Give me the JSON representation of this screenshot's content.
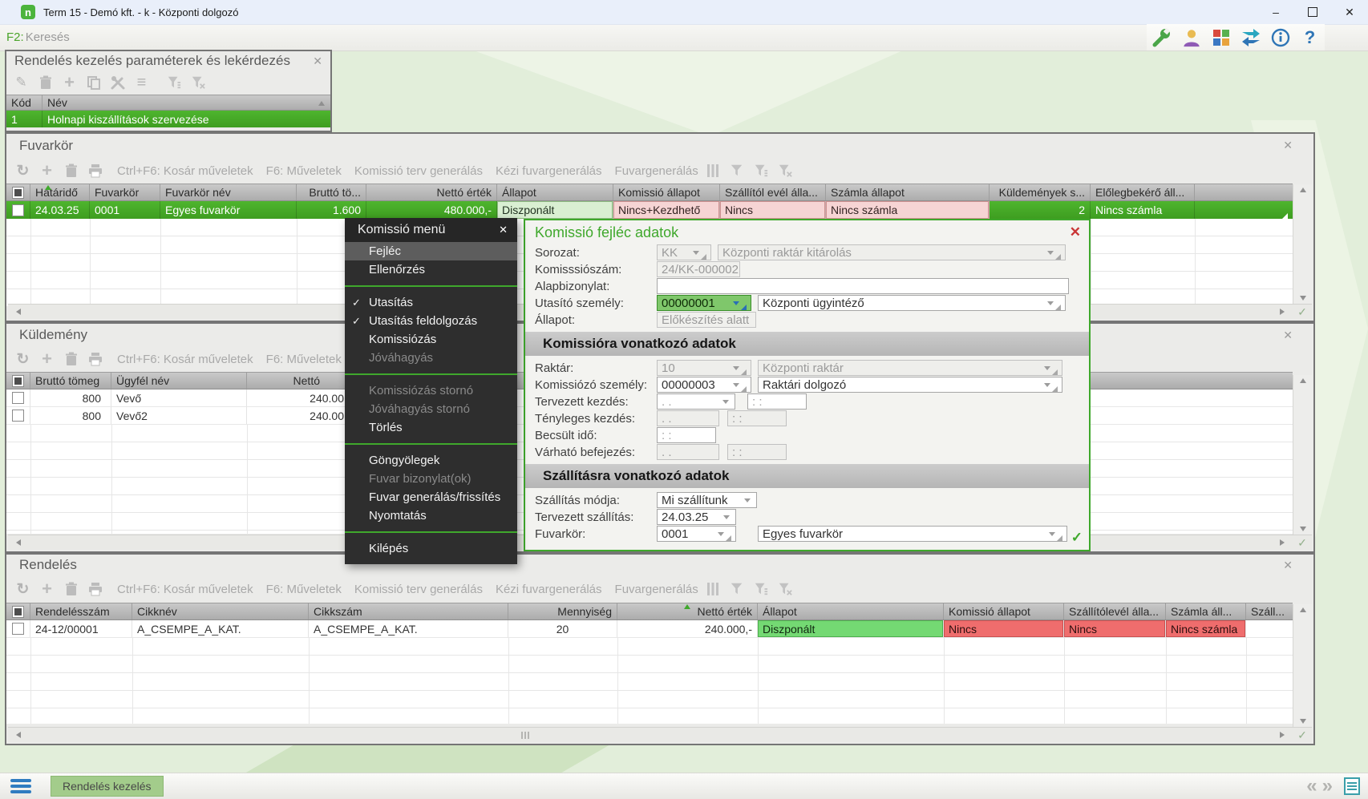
{
  "window": {
    "title": "Term 15 - Demó kft. - k - Központi dolgozó",
    "app_letter": "n",
    "minimize": "–",
    "close": "✕"
  },
  "topbar": {
    "shortcut": "F2:",
    "search_label": "Keresés"
  },
  "ui": {
    "close": "✕",
    "check": "✓"
  },
  "param_panel": {
    "title": "Rendelés kezelés paraméterek és lekérdezés",
    "col_kod": "Kód",
    "col_nev": "Név",
    "row_kod": "1",
    "row_nev": "Holnapi kiszállítások szervezése"
  },
  "toolbar_labels": {
    "kosar": "Ctrl+F6: Kosár műveletek",
    "muveletek": "F6: Műveletek",
    "komissio_terv": "Komissió terv generálás",
    "kezi_fuvar": "Kézi fuvargenerálás",
    "fuvargen": "Fuvargenerálás"
  },
  "fuvarkor": {
    "title": "Fuvarkör",
    "cols": {
      "hatarido": "Határidő",
      "fuvarkor": "Fuvarkör",
      "nev": "Fuvarkör név",
      "brutto": "Bruttó tö...",
      "netto": "Nettó érték",
      "allapot": "Állapot",
      "komissio": "Komissió állapot",
      "szallitolevel": "Szállítól evél álla...",
      "szamla": "Számla állapot",
      "kuldemenyek": "Küldemények s...",
      "eloleg": "Előlegbekérő áll..."
    },
    "row": {
      "hatarido": "24.03.25",
      "fuvarkor": "0001",
      "nev": "Egyes fuvarkör",
      "brutto": "1.600",
      "netto": "480.000,-",
      "allapot": "Diszponált",
      "komissio": "Nincs+Kezdhető",
      "szallitolevel": "Nincs",
      "szamla": "Nincs számla",
      "kuldemenyek": "2",
      "eloleg": "Nincs számla"
    }
  },
  "kuldemeny": {
    "title": "Küldemény",
    "cols": {
      "brutto": "Bruttó tömeg",
      "ugyfel": "Ügyfél név",
      "netto": "Nettó"
    },
    "rows": [
      {
        "brutto": "800",
        "ugyfel": "Vevő",
        "netto": "240.00"
      },
      {
        "brutto": "800",
        "ugyfel": "Vevő2",
        "netto": "240.00"
      }
    ]
  },
  "rendeles": {
    "title": "Rendelés",
    "cols": {
      "szam": "Rendelésszám",
      "cikknev": "Cikknév",
      "cikkszam": "Cikkszám",
      "mennyiseg": "Mennyiség",
      "netto": "Nettó érték",
      "allapot": "Állapot",
      "komissio": "Komissió állapot",
      "szallitolevel": "Szállítólevél álla...",
      "szamla": "Számla áll...",
      "szall": "Száll..."
    },
    "row": {
      "szam": "24-12/00001",
      "cikknev": "A_CSEMPE_A_KAT.",
      "cikkszam": "A_CSEMPE_A_KAT.",
      "mennyiseg": "20",
      "netto": "240.000,-",
      "allapot": "Diszponált",
      "komissio": "Nincs",
      "szallitolevel": "Nincs",
      "szamla": "Nincs számla"
    }
  },
  "menu": {
    "title": "Komissió menü",
    "close": "✕",
    "items": [
      {
        "label": "Fejléc"
      },
      {
        "label": "Ellenőrzés"
      },
      {
        "label": "Utasítás"
      },
      {
        "label": "Utasítás feldolgozás"
      },
      {
        "label": "Komissiózás"
      },
      {
        "label": "Jóváhagyás"
      },
      {
        "label": "Komissiózás stornó"
      },
      {
        "label": "Jóváhagyás stornó"
      },
      {
        "label": "Törlés"
      },
      {
        "label": "Göngyölegek"
      },
      {
        "label": "Fuvar bizonylat(ok)"
      },
      {
        "label": "Fuvar generálás/frissítés"
      },
      {
        "label": "Nyomtatás"
      },
      {
        "label": "Kilépés"
      }
    ]
  },
  "dialog": {
    "title": "Komissió fejléc adatok",
    "close": "✕",
    "confirm": "✓",
    "sections": {
      "komissio": "Komissióra vonatkozó adatok",
      "szallitas": "Szállításra vonatkozó adatok"
    },
    "labels": {
      "sorozat": "Sorozat:",
      "komissioszam": "Komisssiószám:",
      "alapbizonylat": "Alapbizonylat:",
      "utasito": "Utasító személy:",
      "allapot": "Állapot:",
      "raktar": "Raktár:",
      "komissiozo": "Komissiózó személy:",
      "terv_kezdes": "Tervezett kezdés:",
      "teny_kezdes": "Tényleges kezdés:",
      "becsult": "Becsült idő:",
      "varhato": "Várható befejezés:",
      "szall_mod": "Szállítás módja:",
      "terv_szall": "Tervezett szállítás:",
      "fuvarkor": "Fuvarkör:"
    },
    "values": {
      "sorozat_kod": "KK",
      "sorozat_nev": "Központi raktár kitárolás",
      "komissioszam": "24/KK-000002",
      "alapbizonylat": "",
      "utasito_kod": "00000001",
      "utasito_nev": "Központi ügyintéző",
      "allapot": "Előkészítés alatt",
      "raktar_kod": "10",
      "raktar_nev": "Központi raktár",
      "komissiozo_kod": "00000003",
      "komissiozo_nev": "Raktári dolgozó",
      "date_empty": ". .",
      "time_empty": ": :",
      "szall_mod": "Mi szállítunk",
      "terv_szall": "24.03.25",
      "fuvarkor_kod": "0001",
      "fuvarkor_nev": "Egyes fuvarkör"
    }
  },
  "statusbar": {
    "tab": "Rendelés kezelés",
    "prev": "«",
    "next": "»"
  },
  "colors": {
    "accent_green": "#3fa82c",
    "selected_row_green": "#44a727",
    "status_ok": "#74d973",
    "status_error": "#ef6d6d",
    "status_ok_pale": "#d9efd2",
    "status_error_pale": "#f6d4d4",
    "focus_combo_green": "#7fc76b",
    "focus_arrow_blue": "#2a6fb5",
    "menu_bg": "#2e2e2e",
    "dialog_close_red": "#c93535",
    "tab_green": "#a3cc8b"
  }
}
